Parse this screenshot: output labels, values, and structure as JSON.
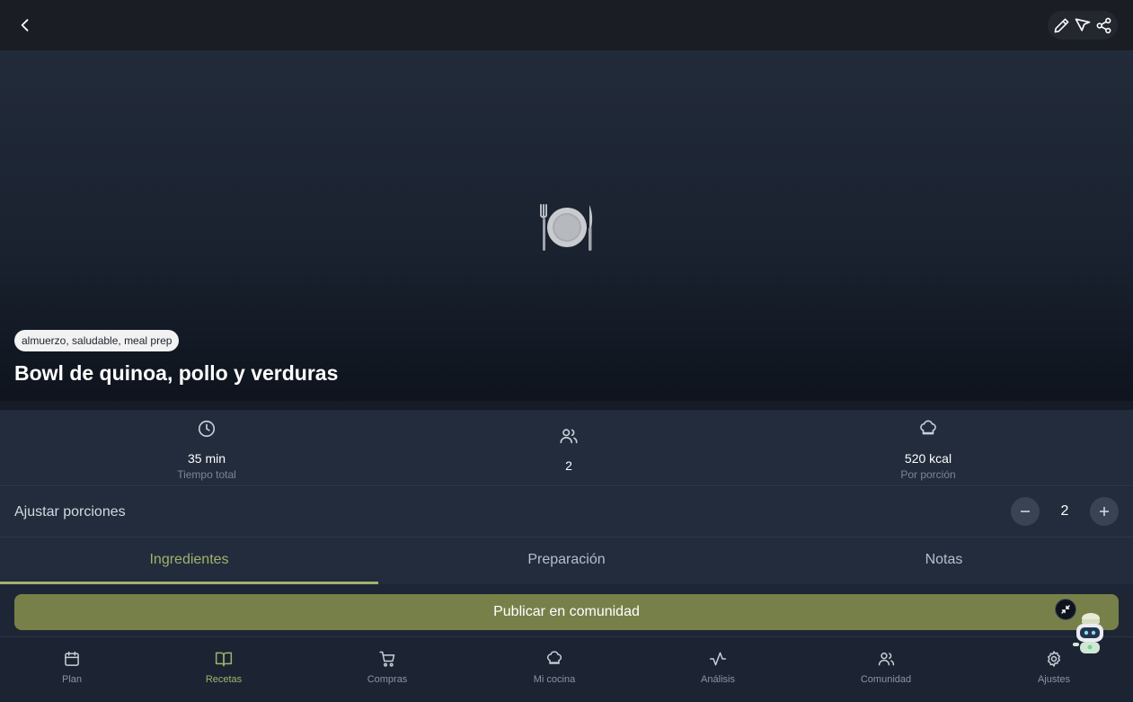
{
  "recipe": {
    "tags": "almuerzo, saludable, meal prep",
    "title": "Bowl de quinoa, pollo y verduras"
  },
  "stats": {
    "time_value": "35 min",
    "time_label": "Tiempo total",
    "servings_value": "2",
    "calories_value": "520 kcal",
    "calories_label": "Por porción"
  },
  "portions": {
    "label": "Ajustar porciones",
    "count": "2"
  },
  "tabs": [
    {
      "label": "Ingredientes",
      "active": true
    },
    {
      "label": "Preparación",
      "active": false
    },
    {
      "label": "Notas",
      "active": false
    }
  ],
  "publish_label": "Publicar en comunidad",
  "bottom_nav": [
    {
      "label": "Plan",
      "icon": "calendar-icon"
    },
    {
      "label": "Recetas",
      "icon": "book-icon",
      "active": true
    },
    {
      "label": "Compras",
      "icon": "cart-icon"
    },
    {
      "label": "Mi cocina",
      "icon": "chef-hat-icon"
    },
    {
      "label": "Análisis",
      "icon": "activity-icon"
    },
    {
      "label": "Comunidad",
      "icon": "users-icon"
    },
    {
      "label": "Ajustes",
      "icon": "gear-icon"
    }
  ],
  "colors": {
    "accent": "#a3b16d",
    "publish_button": "#78804a",
    "background": "#1e2636",
    "topbar": "#1a1d24"
  }
}
